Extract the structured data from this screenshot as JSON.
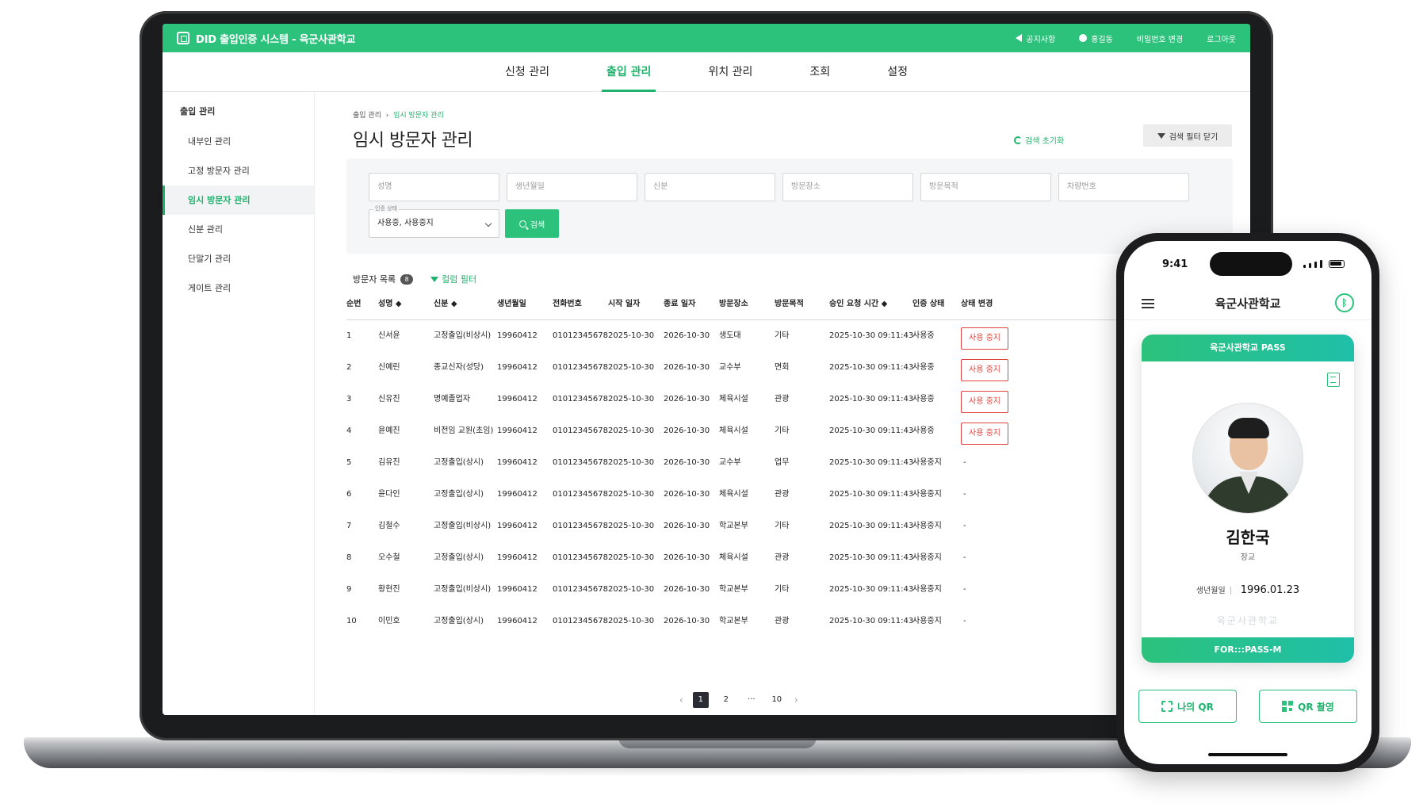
{
  "app": {
    "title": "DID 출입인증 시스템 - 육군사관학교",
    "header_links": [
      "공지사항",
      "홍길동",
      "비밀번호 변경",
      "로그아웃"
    ]
  },
  "topnav": [
    "신청 관리",
    "출입 관리",
    "위치 관리",
    "조회",
    "설정"
  ],
  "sidebar": {
    "title": "출입 관리",
    "items": [
      "내부인 관리",
      "고정 방문자 관리",
      "임시 방문자 관리",
      "신분 관리",
      "단말기 관리",
      "게이트 관리"
    ]
  },
  "breadcrumb": [
    "출입 관리",
    "임시 방문자 관리"
  ],
  "page_title": "임시 방문자 관리",
  "actions": {
    "reset": "검색 초기화",
    "close_filter": "검색 필터 닫기"
  },
  "filters": {
    "placeholders": [
      "성명",
      "생년월일",
      "신분",
      "방문장소",
      "방문목적",
      "차량번호"
    ],
    "status_label": "인증 상태",
    "status_value": "사용중, 사용중지",
    "search": "검색"
  },
  "list": {
    "title": "방문자 목록",
    "count": "8",
    "column_filter": "컬럼 필터"
  },
  "table": {
    "headers": [
      "순번",
      "성명 ◆",
      "신분 ◆",
      "생년월일",
      "전화번호",
      "시작 일자",
      "종료 일자",
      "방문장소",
      "방문목적",
      "승인 요청 시간 ◆",
      "인증 상태",
      "상태 변경"
    ],
    "rows": [
      [
        "1",
        "신서윤",
        "고정출입(비상시)",
        "19960412",
        "01012345678",
        "2025-10-30",
        "2026-10-30",
        "생도대",
        "기타",
        "2025-10-30 09:11:43",
        "사용중",
        "사용 중지"
      ],
      [
        "2",
        "신예린",
        "종교신자(성당)",
        "19960412",
        "01012345678",
        "2025-10-30",
        "2026-10-30",
        "교수부",
        "면회",
        "2025-10-30 09:11:43",
        "사용중",
        "사용 중지"
      ],
      [
        "3",
        "신유진",
        "명예졸업자",
        "19960412",
        "01012345678",
        "2025-10-30",
        "2026-10-30",
        "체육시설",
        "관광",
        "2025-10-30 09:11:43",
        "사용중",
        "사용 중지"
      ],
      [
        "4",
        "윤예진",
        "비전임 교원(초임)",
        "19960412",
        "01012345678",
        "2025-10-30",
        "2026-10-30",
        "체육시설",
        "기타",
        "2025-10-30 09:11:43",
        "사용중",
        "사용 중지"
      ],
      [
        "5",
        "김유진",
        "고정출입(상시)",
        "19960412",
        "01012345678",
        "2025-10-30",
        "2026-10-30",
        "교수부",
        "업무",
        "2025-10-30 09:11:43",
        "사용중지",
        "-"
      ],
      [
        "6",
        "윤다인",
        "고정출입(상시)",
        "19960412",
        "01012345678",
        "2025-10-30",
        "2026-10-30",
        "체육시설",
        "관광",
        "2025-10-30 09:11:43",
        "사용중지",
        "-"
      ],
      [
        "7",
        "김철수",
        "고정출입(비상시)",
        "19960412",
        "01012345678",
        "2025-10-30",
        "2026-10-30",
        "학교본부",
        "기타",
        "2025-10-30 09:11:43",
        "사용중지",
        "-"
      ],
      [
        "8",
        "오수철",
        "고정출입(상시)",
        "19960412",
        "01012345678",
        "2025-10-30",
        "2026-10-30",
        "체육시설",
        "관광",
        "2025-10-30 09:11:43",
        "사용중지",
        "-"
      ],
      [
        "9",
        "황현진",
        "고정출입(비상시)",
        "19960412",
        "01012345678",
        "2025-10-30",
        "2026-10-30",
        "학교본부",
        "기타",
        "2025-10-30 09:11:43",
        "사용중지",
        "-"
      ],
      [
        "10",
        "이민호",
        "고정출입(상시)",
        "19960412",
        "01012345678",
        "2025-10-30",
        "2026-10-30",
        "학교본부",
        "관광",
        "2025-10-30 09:11:43",
        "사용중지",
        "-"
      ]
    ]
  },
  "pagination": {
    "prev": "‹",
    "pages": [
      "1",
      "2",
      "···",
      "10"
    ],
    "next": "›",
    "current": "1"
  },
  "phone": {
    "time": "9:41",
    "title": "육군사관학교",
    "pass_title": "육군사관학교 PASS",
    "name": "김한국",
    "rank": "장교",
    "birth_label": "생년월일",
    "birth_value": "1996.01.23",
    "watermark": "육군사관학교",
    "footer": "FOR:::PASS-M",
    "btn_my_qr": "나의 QR",
    "btn_qr_scan": "QR 촬영"
  },
  "colors": {
    "accent": "#2cc27c",
    "danger": "#e0433d"
  }
}
